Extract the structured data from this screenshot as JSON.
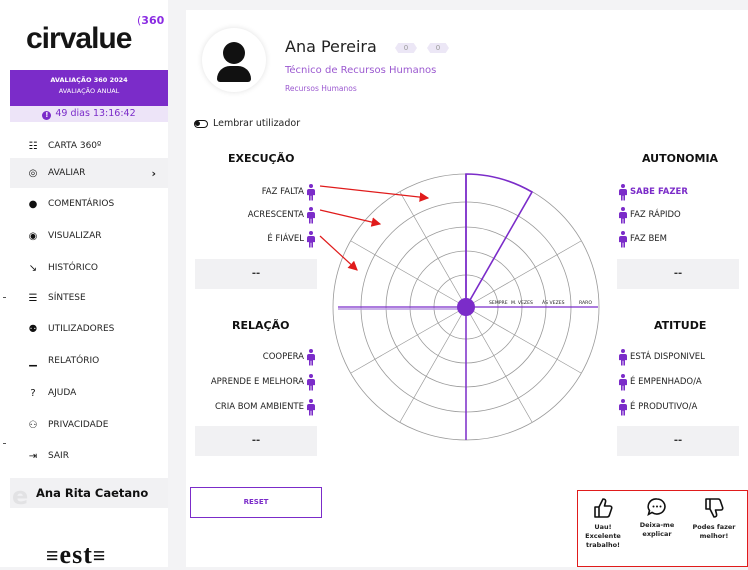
{
  "sidebar": {
    "logo": {
      "text": "cirvalue",
      "sup": "360"
    },
    "evaluation": {
      "title": "AVALIAÇÃO 360 2024",
      "subtitle": "AVALIAÇÃO ANUAL"
    },
    "timer": {
      "icon": "info-icon",
      "text": "49 dias 13:16:42"
    },
    "items": [
      {
        "label": "CARTA 360º",
        "icon": "sitemap-icon",
        "glyph": "☷"
      },
      {
        "label": "AVALIAR",
        "icon": "target-icon",
        "glyph": "◎"
      },
      {
        "label": "COMENTÁRIOS",
        "icon": "comments-icon",
        "glyph": "●"
      },
      {
        "label": "VISUALIZAR",
        "icon": "fingerprint-icon",
        "glyph": "◉"
      },
      {
        "label": "HISTÓRICO",
        "icon": "line-chart-icon",
        "glyph": "↘"
      },
      {
        "label": "SÍNTESE",
        "icon": "list-icon",
        "glyph": "☰"
      },
      {
        "label": "UTILIZADORES",
        "icon": "users-icon",
        "glyph": "⚉"
      },
      {
        "label": "RELATÓRIO",
        "icon": "area-chart-icon",
        "glyph": "▁"
      },
      {
        "label": "AJUDA",
        "icon": "help-icon",
        "glyph": "?"
      },
      {
        "label": "PRIVACIDADE",
        "icon": "user-lock-icon",
        "glyph": "⚇"
      },
      {
        "label": "SAIR",
        "icon": "sign-out-icon",
        "glyph": "⇥"
      }
    ],
    "user_name": "Ana Rita Caetano",
    "footer_logo": "est"
  },
  "profile": {
    "name": "Ana Pereira",
    "badges": [
      "0",
      "0"
    ],
    "role": "Técnico de Recursos Humanos",
    "department": "Recursos Humanos"
  },
  "remember_label": "Lembrar utilizador",
  "sections": {
    "execucao": {
      "title": "EXECUÇÃO",
      "items": [
        "FAZ FALTA",
        "ACRESCENTA",
        "É FIÁVEL"
      ],
      "value": "--"
    },
    "autonomia": {
      "title": "AUTONOMIA",
      "items": [
        "SABE FAZER",
        "FAZ RÁPIDO",
        "FAZ BEM"
      ],
      "selected": "SABE FAZER",
      "value": "--"
    },
    "relacao": {
      "title": "RELAÇÃO",
      "items": [
        "COOPERA",
        "APRENDE E MELHORA",
        "CRIA BOM AMBIENTE"
      ],
      "value": "--"
    },
    "atitude": {
      "title": "ATITUDE",
      "items": [
        "ESTÁ DISPONIVEL",
        "É EMPENHADO/A",
        "É PRODUTIVO/A"
      ],
      "value": "--"
    }
  },
  "radar": {
    "scale_labels": [
      "SEMPRE",
      "M. VEZES",
      "ÀS VEZES",
      "RARO"
    ],
    "accent": "#7b2cc9",
    "arrow_color": "#e01b1b"
  },
  "reset_label": "RESET",
  "feedback": [
    {
      "icon": "thumbs-up-icon",
      "label": "Uau! Excelente trabalho!"
    },
    {
      "icon": "comment-icon",
      "label": "Deixa-me explicar"
    },
    {
      "icon": "thumbs-down-icon",
      "label": "Podes fazer melhor!"
    }
  ]
}
